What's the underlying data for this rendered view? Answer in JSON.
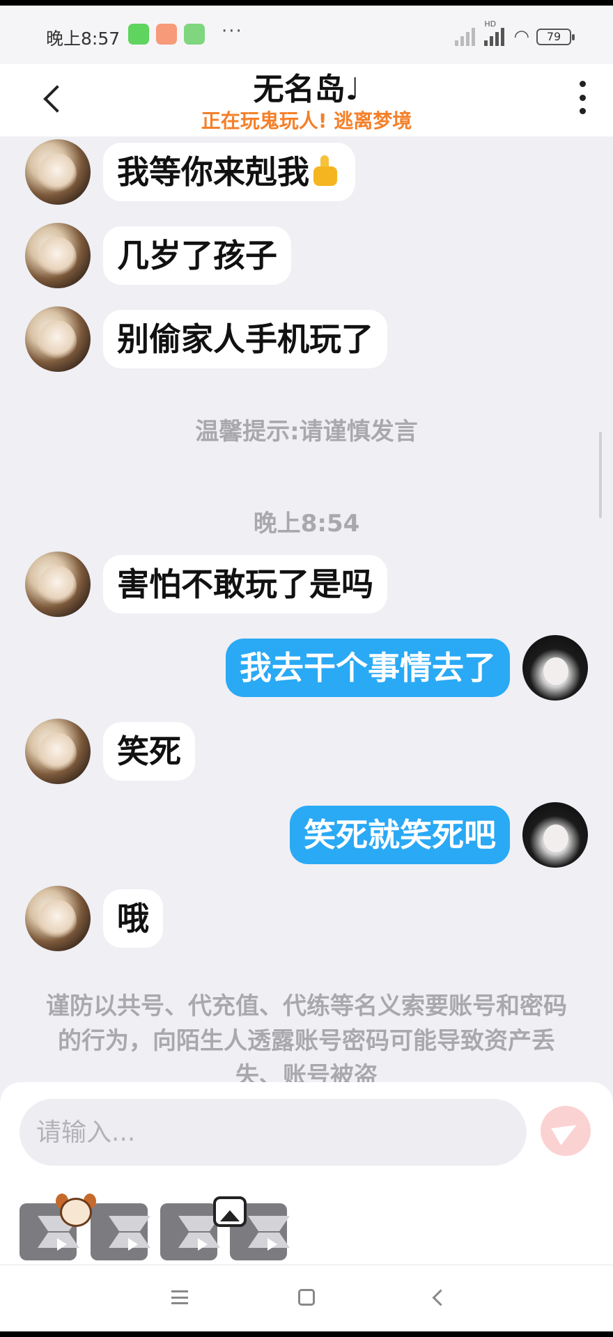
{
  "status_bar": {
    "time": "晚上8:57",
    "dots": "···",
    "battery": "79",
    "network": "HD",
    "app_icons": [
      {
        "icon": "wechat-icon",
        "color": "#5fd45f"
      },
      {
        "icon": "video-icon",
        "color": "#f79a7a"
      },
      {
        "icon": "bot-icon",
        "color": "#7fd67f"
      }
    ]
  },
  "header": {
    "title": "无名岛♩",
    "subtitle": "正在玩鬼玩人! 逃离梦境"
  },
  "messages": [
    {
      "side": "left",
      "text": "我等你来剋我",
      "emoji": "thumbs-up-icon"
    },
    {
      "side": "left",
      "text": "几岁了孩子"
    },
    {
      "side": "left",
      "text": "别偷家人手机玩了"
    },
    {
      "side": "left",
      "text": "害怕不敢玩了是吗"
    },
    {
      "side": "right",
      "text": "我去干个事情去了"
    },
    {
      "side": "left",
      "text": "笑死"
    },
    {
      "side": "right",
      "text": "笑死就笑死吧"
    },
    {
      "side": "left",
      "text": "哦"
    }
  ],
  "system": {
    "tip": "温馨提示:请谨慎发言",
    "time": "晚上8:54",
    "warning": "谨防以共号、代充值、代练等名义索要账号和密码的行为，向陌生人透露账号密码可能导致资产丢失、账号被盗"
  },
  "input": {
    "placeholder": "请输入..."
  },
  "colors": {
    "accent_blue": "#2aa9f5",
    "subtitle_orange": "#f4802a",
    "send_disabled": "#fbd2d2",
    "background": "#efeff4"
  }
}
